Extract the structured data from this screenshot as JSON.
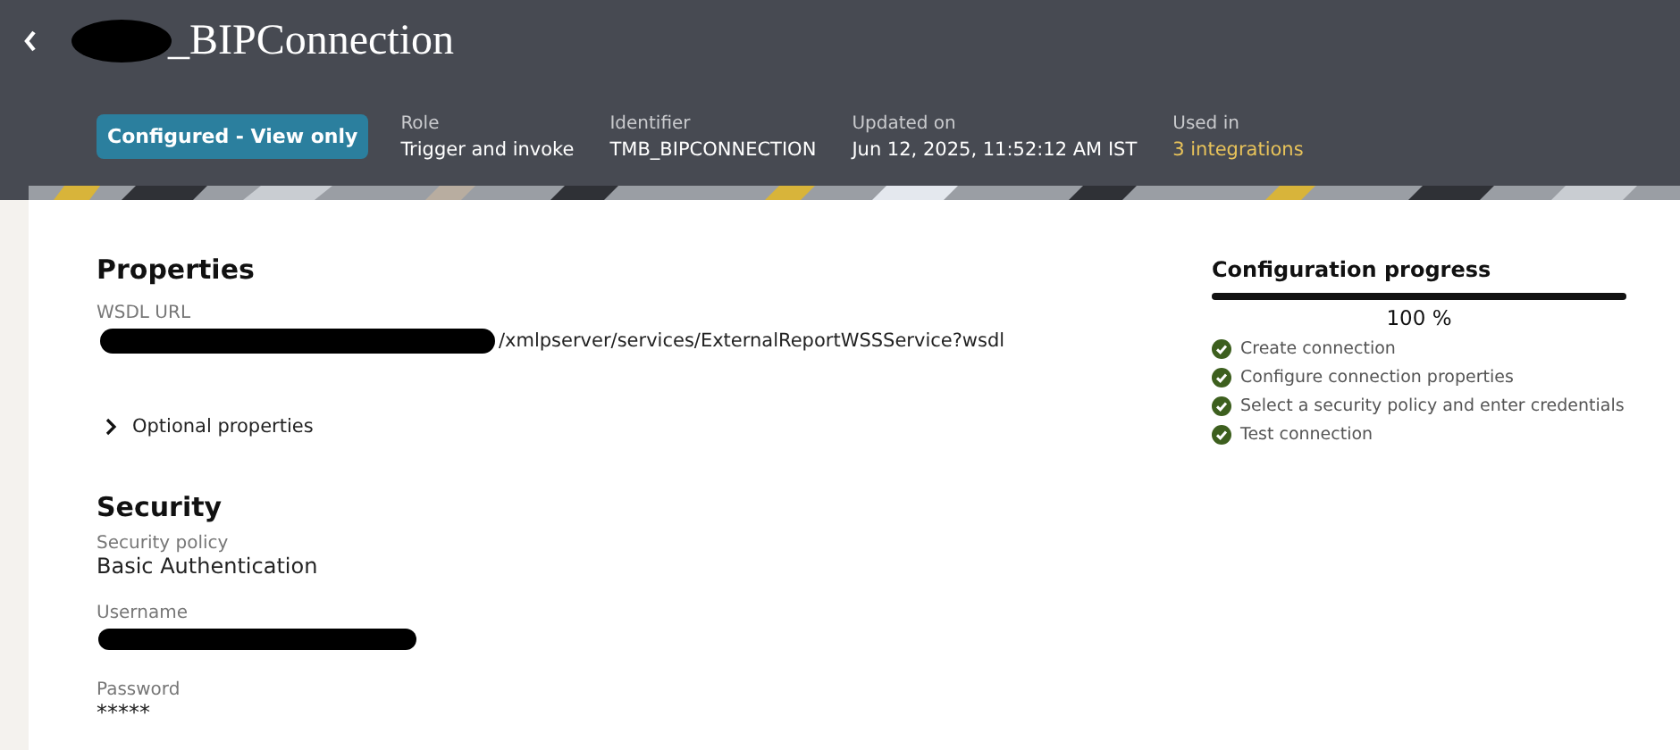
{
  "header": {
    "title": "_BIPConnection",
    "title_redacted": true,
    "status": "Configured - View only",
    "meta": [
      {
        "label": "Role",
        "value": "Trigger and invoke",
        "kind": "text"
      },
      {
        "label": "Identifier",
        "value": "TMB_BIPCONNECTION",
        "kind": "text"
      },
      {
        "label": "Updated on",
        "value": "Jun 12, 2025, 11:52:12 AM IST",
        "kind": "text"
      },
      {
        "label": "Used in",
        "value": "3 integrations",
        "kind": "link"
      }
    ]
  },
  "properties": {
    "heading": "Properties",
    "fields": [
      {
        "label": "WSDL URL",
        "value": "/xmlpserver/services/ExternalReportWSSService?wsdl",
        "redacted": true
      }
    ],
    "optional": {
      "label": "Optional properties",
      "expanded": false
    }
  },
  "security": {
    "heading": "Security",
    "fields": [
      {
        "label": "Security policy",
        "value": "Basic Authentication",
        "redacted": false
      },
      {
        "label": "Username",
        "redacted": true
      },
      {
        "label": "Password",
        "value": "*****",
        "redacted": false
      }
    ]
  },
  "progress": {
    "title": "Configuration progress",
    "level": 1,
    "reading": "100 %",
    "steps": [
      {
        "label": "Create connection",
        "done": true
      },
      {
        "label": "Configure connection properties",
        "done": true
      },
      {
        "label": "Select a security policy and enter credentials",
        "done": true
      },
      {
        "label": "Test connection",
        "done": true
      }
    ]
  }
}
